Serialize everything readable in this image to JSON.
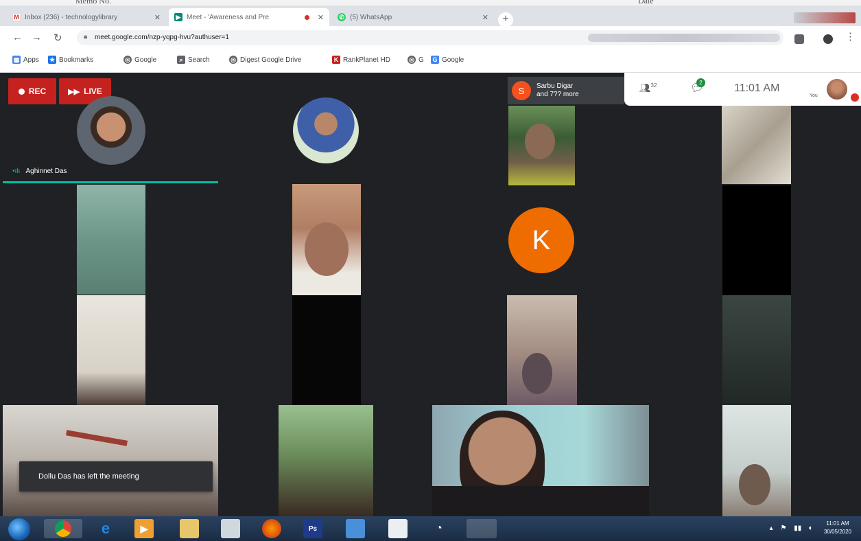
{
  "paper": {
    "memo_label": "Memo No.",
    "date_label": "Date"
  },
  "browser": {
    "tabs": [
      {
        "title": "Inbox (236) - technologylibrary",
        "icon": "gmail-icon",
        "active": false
      },
      {
        "title": "Meet - 'Awareness and Pre",
        "icon": "meet-icon",
        "active": true,
        "recording": true
      },
      {
        "title": "(5) WhatsApp",
        "icon": "whatsapp-icon",
        "active": false
      }
    ],
    "new_tab": "+",
    "url": "meet.google.com/nzp-yqpg-hvu?authuser=1",
    "bookmarks": [
      {
        "label": "Apps",
        "icon": "apps-icon"
      },
      {
        "label": "Bookmarks",
        "icon": "star-icon"
      },
      {
        "label": "Google",
        "icon": "globe-icon"
      },
      {
        "label": "Search",
        "icon": "search-icon"
      },
      {
        "label": "Digest Google Drive",
        "icon": "globe-icon"
      },
      {
        "label": "RankPlanet HD",
        "icon": "rank-icon"
      },
      {
        "label": "G",
        "icon": "globe-icon"
      },
      {
        "label": "Google",
        "icon": "google-icon"
      }
    ]
  },
  "meet": {
    "rec_label": "REC",
    "live_label": "LIVE",
    "chat_toast": {
      "initial": "S",
      "line1": "Sarbu Digar",
      "line2": "and 7?? more"
    },
    "people_count": "32",
    "chat_badge": "2",
    "clock": "11:01 AM",
    "you_label": "You",
    "speaker_name": "Aghinnet Das",
    "k_initial": "K",
    "toast_message": "Dollu Das has left the meeting"
  },
  "taskbar": {
    "time": "11:01 AM",
    "date": "30/05/2020"
  }
}
